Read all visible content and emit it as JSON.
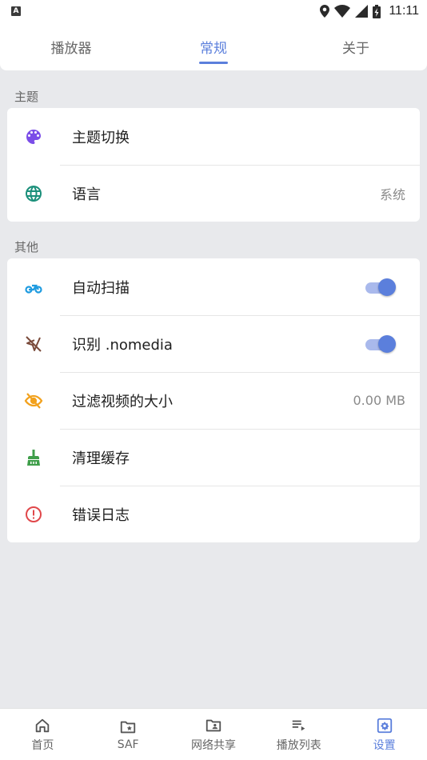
{
  "status_bar": {
    "time": "11:11",
    "notification_glyph": "A"
  },
  "tabs": [
    {
      "label": "播放器",
      "active": false
    },
    {
      "label": "常规",
      "active": true
    },
    {
      "label": "关于",
      "active": false
    }
  ],
  "sections": {
    "theme": {
      "label": "主题",
      "items": [
        {
          "label": "主题切换",
          "icon": "palette-icon",
          "icon_color": "#7b4de8"
        },
        {
          "label": "语言",
          "value": "系统",
          "icon": "globe-icon",
          "icon_color": "#1a8f7a"
        }
      ]
    },
    "other": {
      "label": "其他",
      "items": [
        {
          "label": "自动扫描",
          "icon": "bike-icon",
          "icon_color": "#1e9be0",
          "toggle": true
        },
        {
          "label": "识别 .nomedia",
          "icon": "location-off-icon",
          "icon_color": "#7a4a3a",
          "toggle": true
        },
        {
          "label": "过滤视频的大小",
          "value": "0.00 MB",
          "icon": "visibility-off-icon",
          "icon_color": "#f2a11c"
        },
        {
          "label": "清理缓存",
          "icon": "broom-icon",
          "icon_color": "#3f9e4a"
        },
        {
          "label": "错误日志",
          "icon": "error-icon",
          "icon_color": "#e0474a"
        }
      ]
    }
  },
  "bottom_nav": [
    {
      "label": "首页",
      "icon": "home-icon",
      "active": false
    },
    {
      "label": "SAF",
      "icon": "folder-star-icon",
      "active": false
    },
    {
      "label": "网络共享",
      "icon": "folder-shared-icon",
      "active": false
    },
    {
      "label": "播放列表",
      "icon": "playlist-icon",
      "active": false
    },
    {
      "label": "设置",
      "icon": "settings-icon",
      "active": true
    }
  ],
  "colors": {
    "accent": "#5b7fdc",
    "toggle_track": "#a9b9ec",
    "background": "#e8e9ec"
  }
}
